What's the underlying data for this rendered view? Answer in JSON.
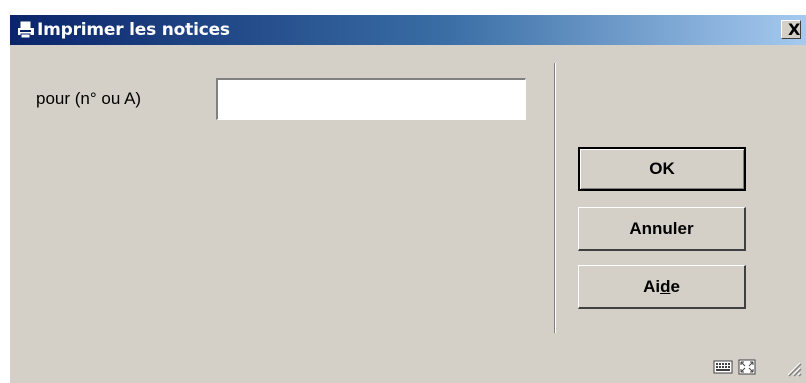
{
  "window": {
    "title": "Imprimer les notices",
    "title_icon": "printer-icon",
    "close_label": "X"
  },
  "form": {
    "field_label": "pour (n° ou A)",
    "field_value": "",
    "field_placeholder": ""
  },
  "buttons": {
    "ok_label": "OK",
    "cancel_label": "Annuler",
    "help_label_prefix": "Ai",
    "help_label_underlined": "d",
    "help_label_suffix": "e"
  },
  "statusbar": {
    "icons": [
      "keyboard-grid-icon",
      "expand-window-icon",
      "resize-grip-icon"
    ]
  },
  "colors": {
    "titlebar_start": "#0a246a",
    "titlebar_end": "#a6caf0",
    "dialog_bg": "#d4d0c8"
  }
}
